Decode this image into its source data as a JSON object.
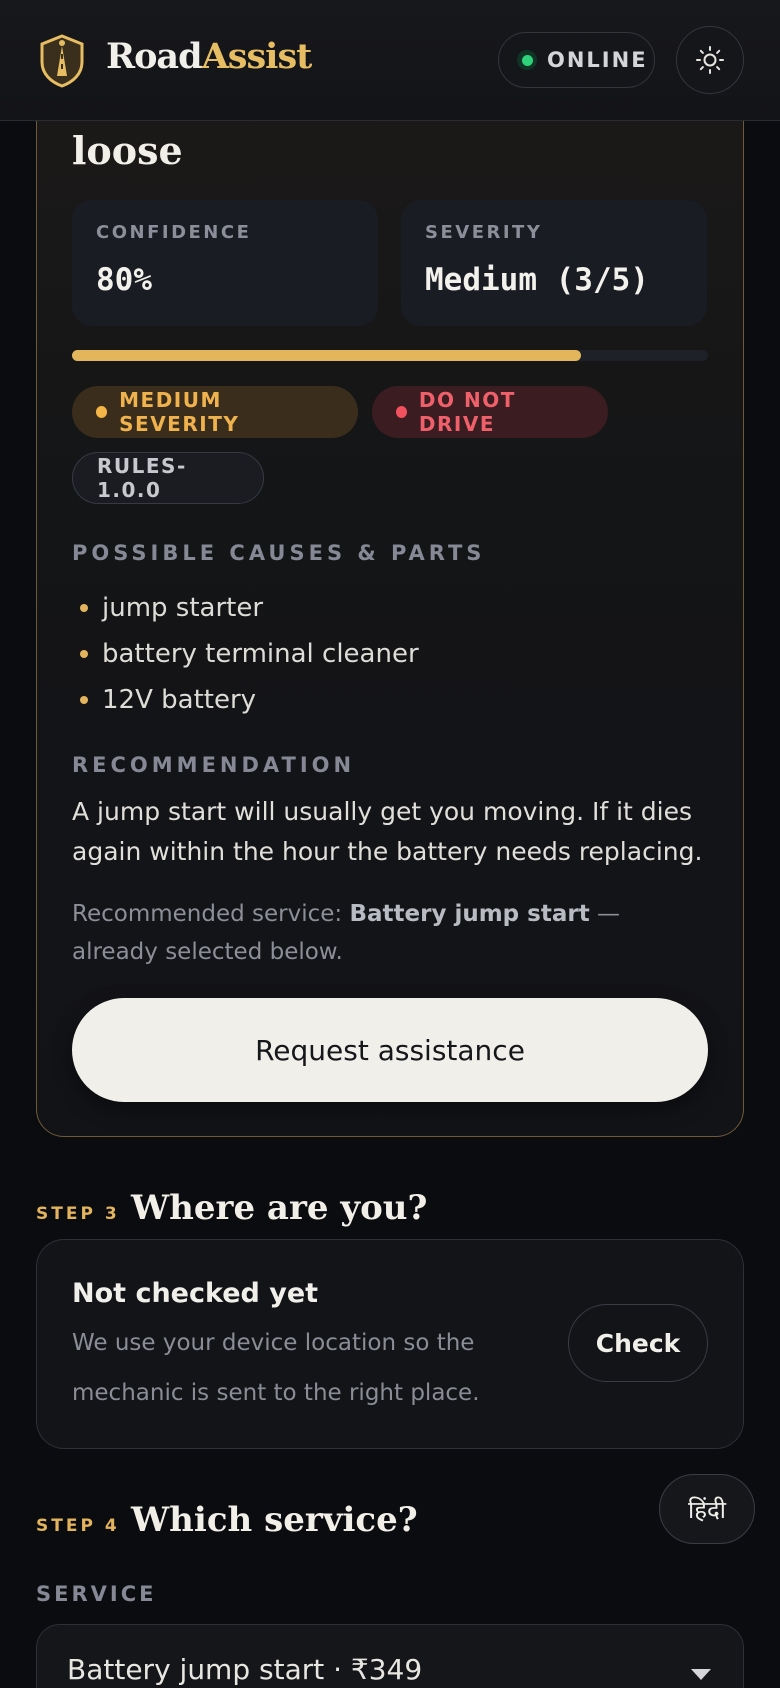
{
  "header": {
    "brand_primary": "Road",
    "brand_accent": "Assist",
    "status": "ONLINE",
    "status_color": "#2fd27a",
    "theme_toggle_icon": "sun-icon",
    "logo_icon": "shield-road-icon"
  },
  "diagnosis": {
    "title_tail": "loose",
    "confidence_label": "CONFIDENCE",
    "confidence_value": "80%",
    "confidence_fraction": 0.8,
    "severity_label": "SEVERITY",
    "severity_value": "Medium (3/5)",
    "badges": {
      "severity": "MEDIUM SEVERITY",
      "drive": "DO NOT DRIVE",
      "rules": "RULES-1.0.0"
    },
    "causes_label": "POSSIBLE CAUSES & PARTS",
    "causes": [
      "jump starter",
      "battery terminal cleaner",
      "12V battery"
    ],
    "recommendation_label": "RECOMMENDATION",
    "recommendation": "A jump start will usually get you moving. If it dies again within the hour the battery needs replacing.",
    "service_prefix": "Recommended service: ",
    "service_name": "Battery jump start",
    "service_suffix": " — already selected below.",
    "request_button": "Request assistance",
    "accent_color": "#e4b65c"
  },
  "step3": {
    "tag": "STEP 3",
    "title": "Where are you?",
    "location_status": "Not checked yet",
    "location_desc": "We use your device location so the mechanic is sent to the right place.",
    "check_button": "Check"
  },
  "language_button": "हिंदी",
  "step4": {
    "tag": "STEP 4",
    "title": "Which service?",
    "service_label": "SERVICE",
    "selected_service": "Battery jump start · ₹349"
  }
}
